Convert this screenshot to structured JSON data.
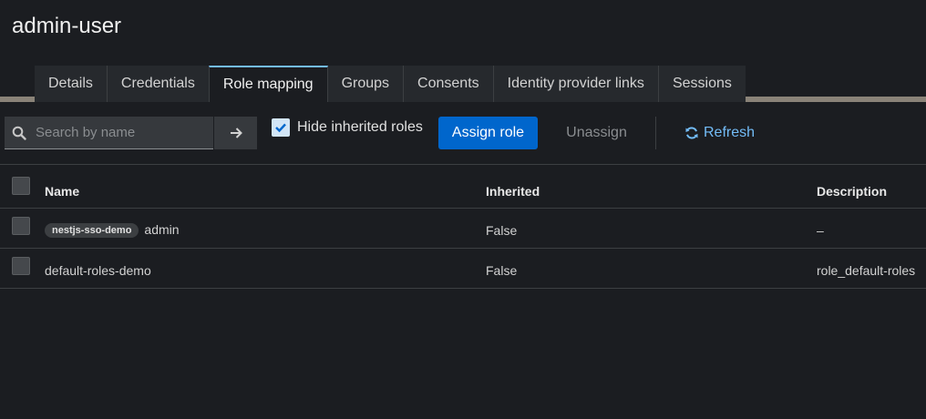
{
  "page": {
    "title": "admin-user"
  },
  "tabs": [
    {
      "label": "Details"
    },
    {
      "label": "Credentials"
    },
    {
      "label": "Role mapping"
    },
    {
      "label": "Groups"
    },
    {
      "label": "Consents"
    },
    {
      "label": "Identity provider links"
    },
    {
      "label": "Sessions"
    }
  ],
  "toolbar": {
    "search_placeholder": "Search by name",
    "search_icon": "search-icon",
    "go_icon": "arrow-right-icon",
    "hide_inherited_label": "Hide inherited roles",
    "hide_inherited_checked": true,
    "assign_label": "Assign role",
    "unassign_label": "Unassign",
    "refresh_label": "Refresh",
    "refresh_icon": "sync-icon"
  },
  "table": {
    "columns": [
      "Name",
      "Inherited",
      "Description"
    ],
    "rows": [
      {
        "badge": "nestjs-sso-demo",
        "name": "admin",
        "inherited": "False",
        "description": "–"
      },
      {
        "badge": "",
        "name": "default-roles-demo",
        "inherited": "False",
        "description": "role_default-roles"
      }
    ]
  },
  "colors": {
    "background": "#1b1d21",
    "accent": "#0066cc",
    "link": "#73bcf7",
    "tab_bar": "#8a8378"
  }
}
